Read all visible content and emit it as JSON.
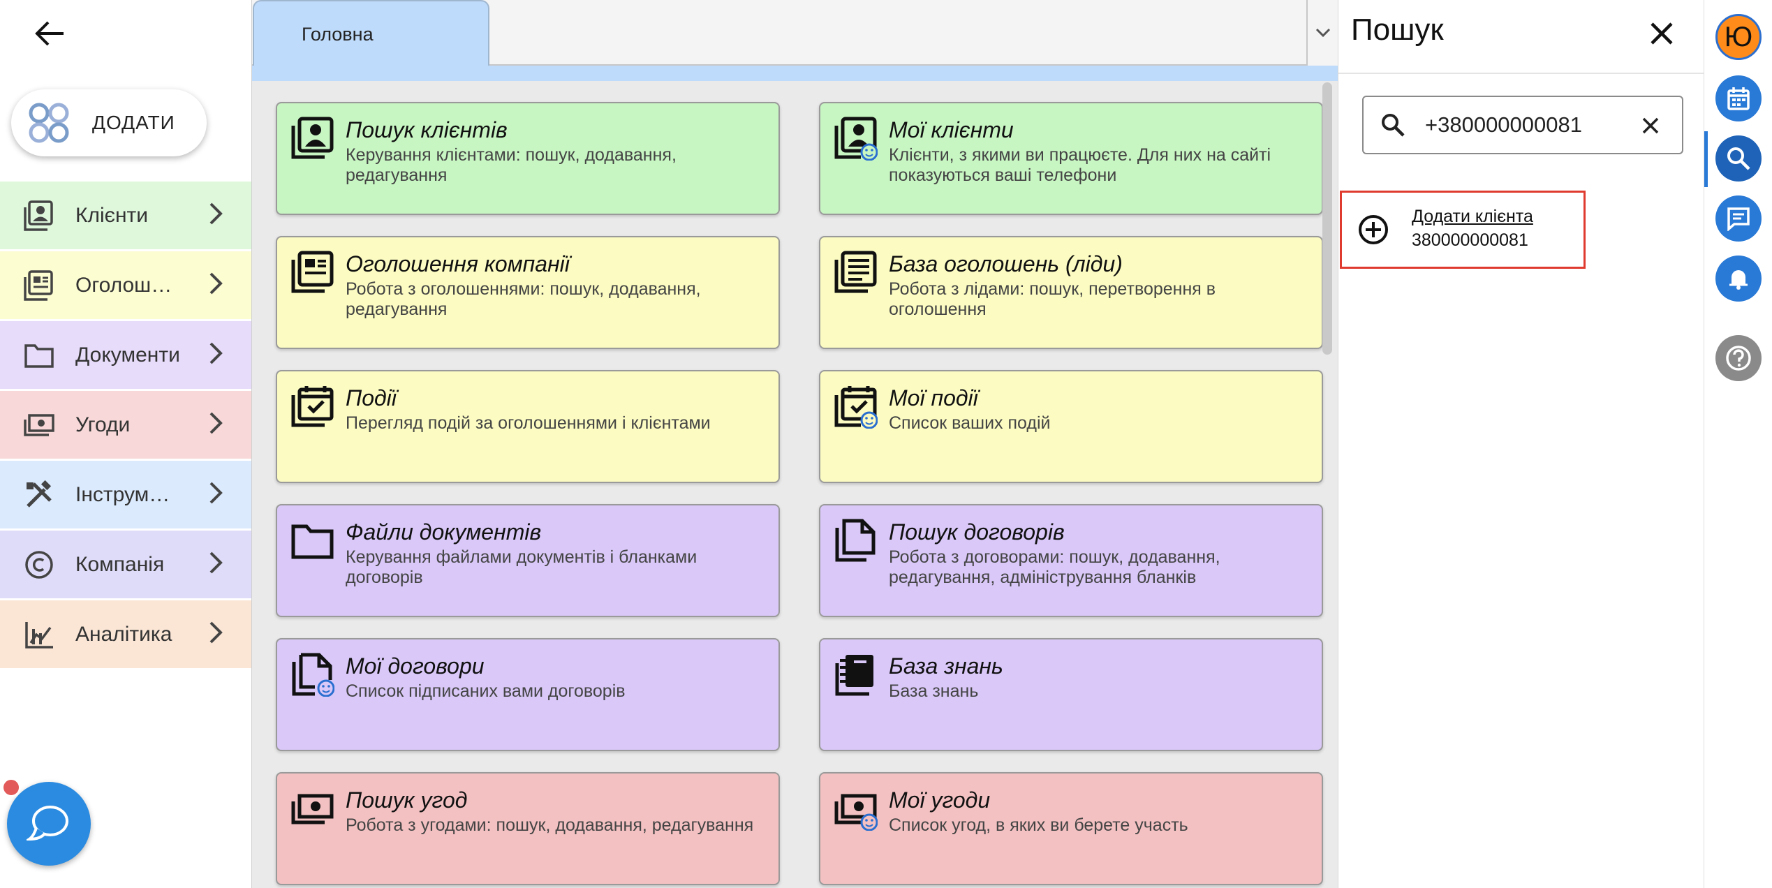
{
  "sidebar": {
    "add_label": "ДОДАТИ",
    "items": [
      {
        "label": "Клієнти",
        "color": "#dff8dc",
        "icon": "contacts-icon"
      },
      {
        "label": "Оголошення",
        "color": "#fdfdd2",
        "icon": "listings-icon"
      },
      {
        "label": "Документи",
        "color": "#e8dcfb",
        "icon": "folder-icon"
      },
      {
        "label": "Угоди",
        "color": "#f8d8d8",
        "icon": "money-icon"
      },
      {
        "label": "Інструменти",
        "color": "#dbeafd",
        "icon": "tools-icon"
      },
      {
        "label": "Компанія",
        "color": "#dedcf8",
        "icon": "copyright-icon"
      },
      {
        "label": "Аналітика",
        "color": "#fbe6d6",
        "icon": "analytics-icon"
      }
    ]
  },
  "main": {
    "tab_label": "Головна",
    "cards": [
      {
        "title": "Пошук клієнтів",
        "desc": "Керування клієнтами: пошук, додавання, редагування",
        "color": "green",
        "icon": "contacts-icon"
      },
      {
        "title": "Мої клієнти",
        "desc": "Клієнти, з якими ви працюєте. Для них на сайті показуються ваші телефони",
        "color": "green",
        "icon": "my-contacts-icon"
      },
      {
        "title": "Оголошення компанії",
        "desc": "Робота з оголошеннями: пошук, додавання, редагування",
        "color": "yellow",
        "icon": "listings-icon"
      },
      {
        "title": "База оголошень (ліди)",
        "desc": "Робота з лідами: пошук, перетворення в оголошення",
        "color": "yellow",
        "icon": "article-icon"
      },
      {
        "title": "Події",
        "desc": "Перегляд подій за оголошеннями і клієнтами",
        "color": "yellow",
        "icon": "events-icon"
      },
      {
        "title": "Мої події",
        "desc": "Список ваших подій",
        "color": "yellow",
        "icon": "my-events-icon"
      },
      {
        "title": "Файли документів",
        "desc": "Керування файлами документів і бланками договорів",
        "color": "purple",
        "icon": "folder-icon"
      },
      {
        "title": "Пошук договорів",
        "desc": "Робота з договорами: пошук, додавання, редагування, адміністрування бланків",
        "color": "purple",
        "icon": "contracts-icon"
      },
      {
        "title": "Мої договори",
        "desc": "Список підписаних вами договорів",
        "color": "purple",
        "icon": "my-contracts-icon"
      },
      {
        "title": "База знань",
        "desc": "База знань",
        "color": "purple",
        "icon": "knowledge-icon"
      },
      {
        "title": "Пошук угод",
        "desc": "Робота з угодами: пошук, додавання, редагування",
        "color": "red",
        "icon": "money-icon"
      },
      {
        "title": "Мої угоди",
        "desc": "Список угод, в яких ви берете участь",
        "color": "red",
        "icon": "my-deals-icon"
      }
    ]
  },
  "search": {
    "title": "Пошук",
    "value": "+380000000081",
    "result_title": "Додати клієнта",
    "result_sub": "380000000081"
  },
  "rail": {
    "avatar_letter": "Ю"
  }
}
